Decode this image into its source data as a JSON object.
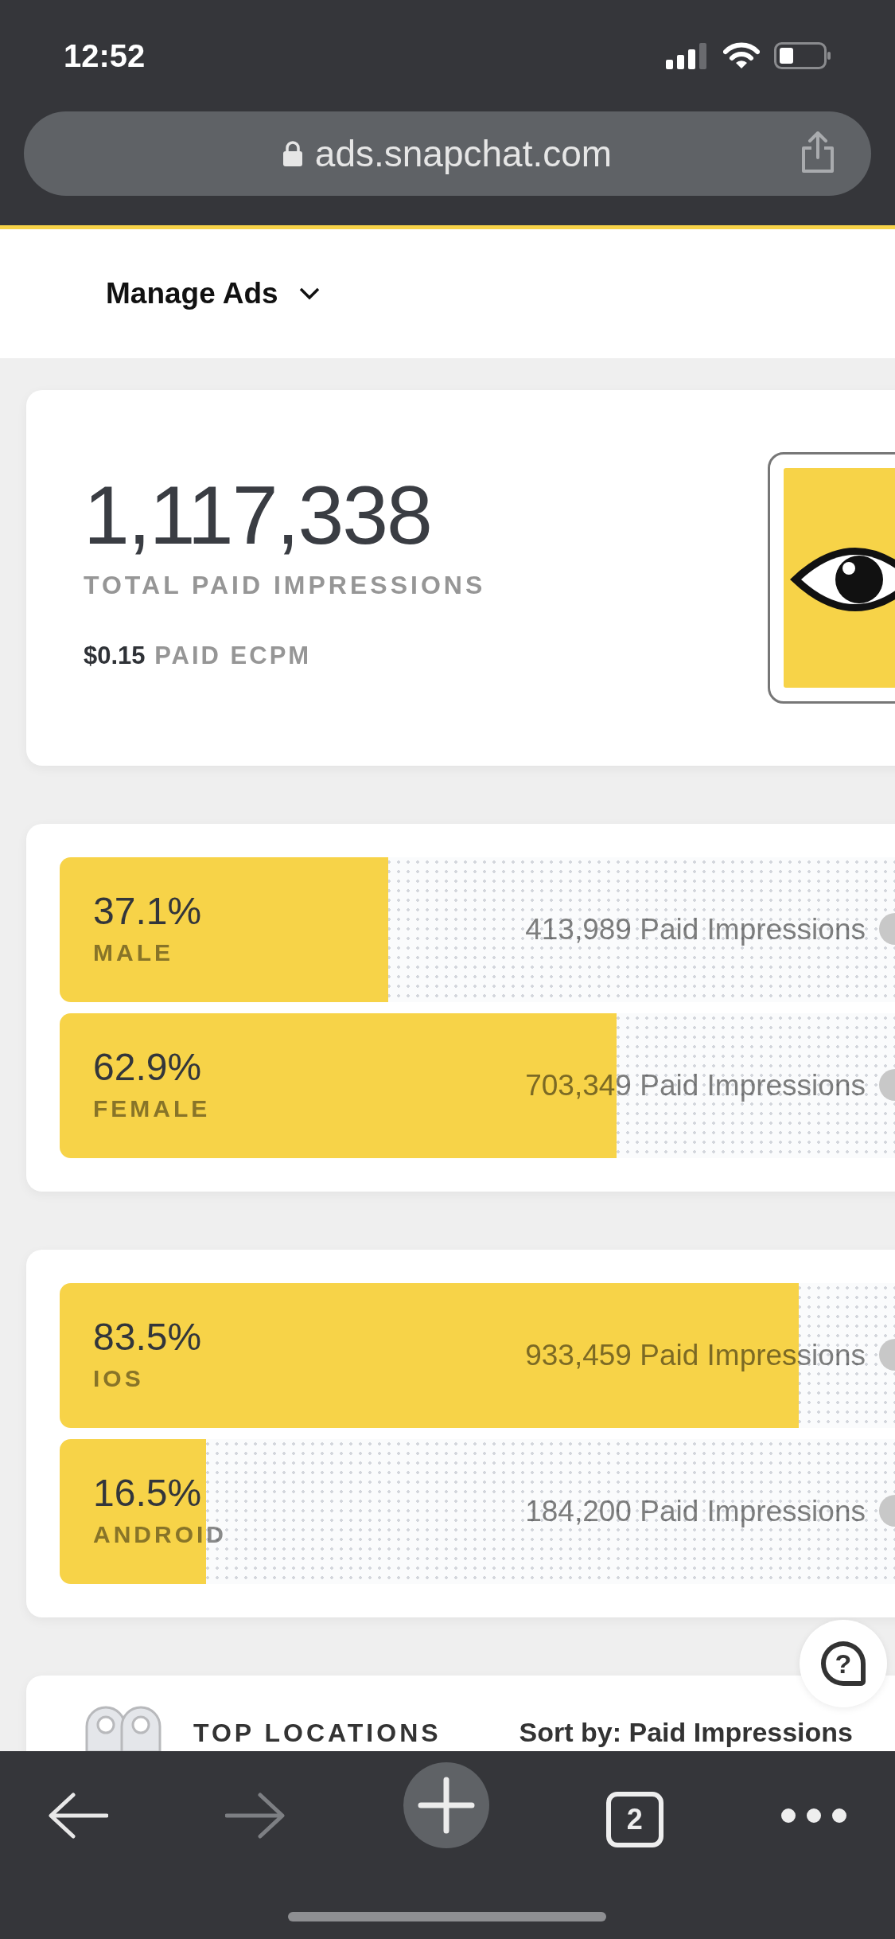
{
  "status_bar": {
    "time": "12:52"
  },
  "browser": {
    "url": "ads.snapchat.com"
  },
  "nav": {
    "menu": "Manage Ads"
  },
  "summary": {
    "total": "1,117,338",
    "total_label": "TOTAL PAID IMPRESSIONS",
    "ecpm": "$0.15",
    "ecpm_label": "PAID ECPM"
  },
  "breakdowns": [
    {
      "rows": [
        {
          "percent": "37.1%",
          "label": "MALE",
          "level": 0.371,
          "impressions": "413,989 Paid Impressions"
        },
        {
          "percent": "62.9%",
          "label": "FEMALE",
          "level": 0.629,
          "impressions": "703,349 Paid Impressions"
        }
      ]
    },
    {
      "rows": [
        {
          "percent": "83.5%",
          "label": "IOS",
          "level": 0.835,
          "impressions": "933,459 Paid Impressions"
        },
        {
          "percent": "16.5%",
          "label": "ANDROID",
          "level": 0.165,
          "impressions": "184,200 Paid Impressions"
        }
      ]
    }
  ],
  "top_locations": {
    "title": "TOP LOCATIONS",
    "sort": "Sort by: Paid Impressions"
  },
  "help_button": {
    "label": "?"
  },
  "toolbar": {
    "back": {
      "disabled": false
    },
    "forward": {
      "disabled": true
    },
    "tabs_count": "2"
  }
}
